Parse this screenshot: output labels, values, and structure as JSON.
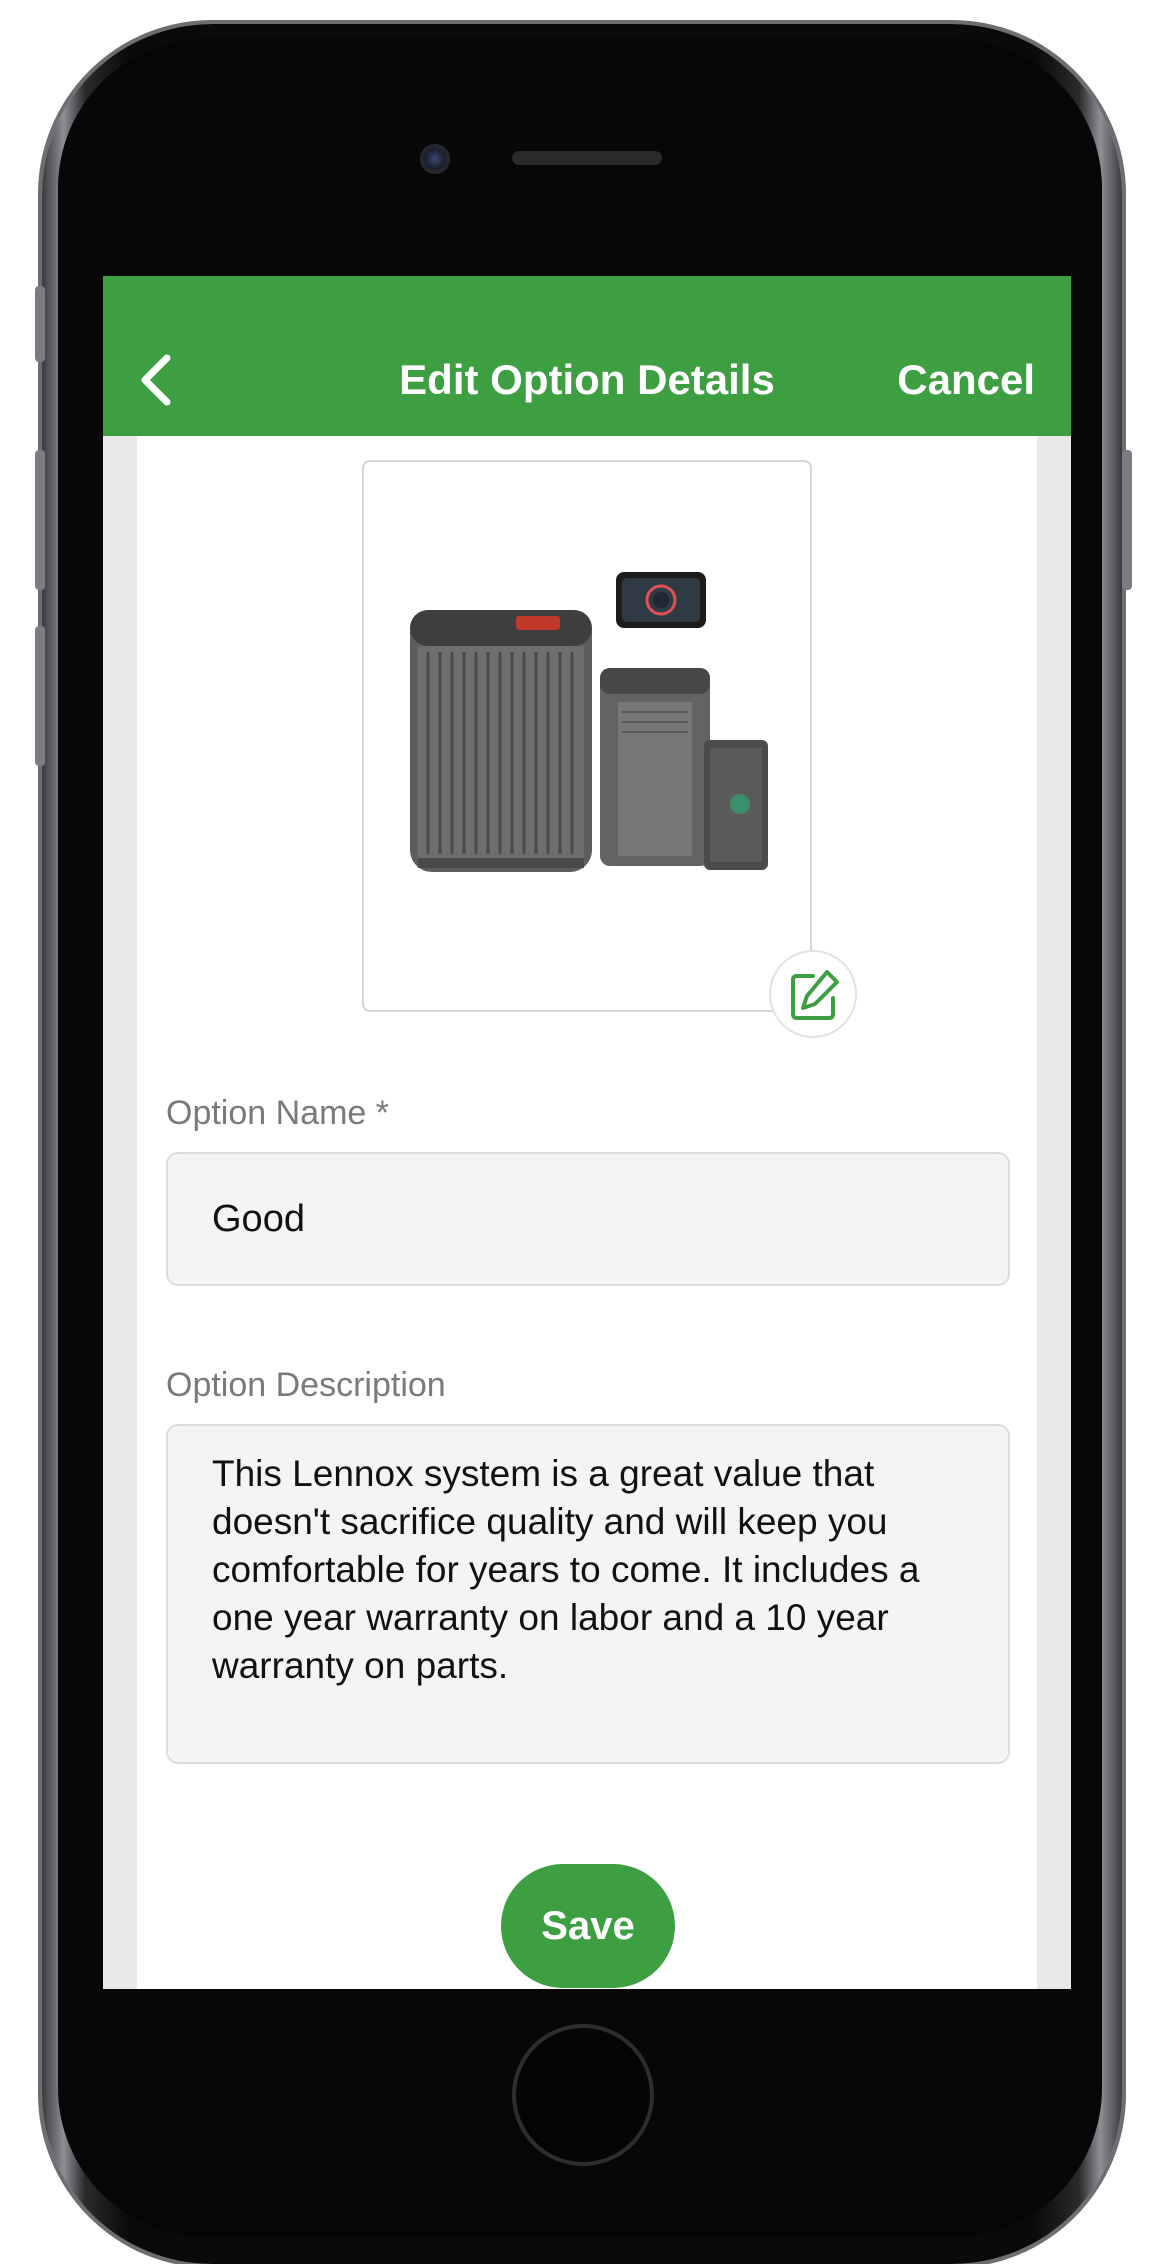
{
  "header": {
    "title": "Edit Option Details",
    "cancel_label": "Cancel",
    "back_icon": "chevron-left-icon"
  },
  "product_image": {
    "edit_icon": "edit-square-icon"
  },
  "form": {
    "name_label": "Option Name *",
    "name_value": "Good",
    "description_label": "Option Description",
    "description_value": "This Lennox system is a great value that doesn't sacrifice quality and will keep you comfortable for years to come. It includes a one year warranty on labor and a 10 year warranty on parts.",
    "save_label": "Save"
  },
  "colors": {
    "accent": "#3d9f42",
    "input_background": "#f4f4f4",
    "label_gray": "#7a7a7a"
  }
}
